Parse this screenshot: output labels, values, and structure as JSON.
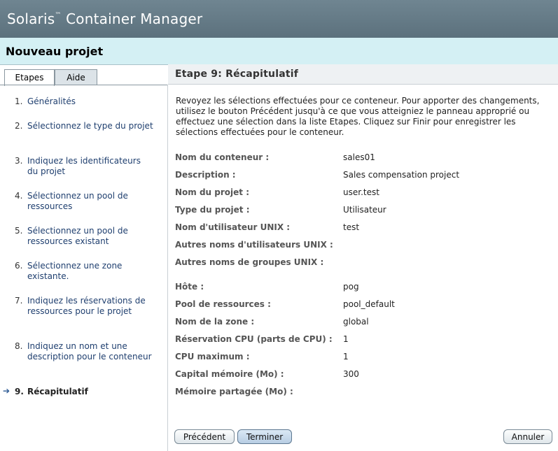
{
  "app": {
    "title": "Solaris",
    "trademark": "™",
    "title_rest": " Container Manager"
  },
  "page_title": "Nouveau projet",
  "tabs": [
    {
      "label": "Etapes",
      "active": true
    },
    {
      "label": "Aide",
      "active": false
    }
  ],
  "steps": [
    {
      "num": "1.",
      "label": "Généralités"
    },
    {
      "num": "2.",
      "label": "Sélectionnez le type du projet"
    },
    {
      "num": "3.",
      "label": "Indiquez les identificateurs du projet"
    },
    {
      "num": "4.",
      "label": "Sélectionnez un pool de ressources"
    },
    {
      "num": "5.",
      "label": "Sélectionnez un pool de ressources existant"
    },
    {
      "num": "6.",
      "label": "Sélectionnez une zone existante."
    },
    {
      "num": "7.",
      "label": "Indiquez les réservations de ressources pour le projet"
    },
    {
      "num": "8.",
      "label": "Indiquez un nom et une description pour le conteneur"
    },
    {
      "num": "9.",
      "label": "Récapitulatif",
      "current": true
    }
  ],
  "step_header": "Etape 9:  Récapitulatif",
  "intro": "Revoyez les sélections effectuées pour ce conteneur. Pour apporter des changements, utilisez le bouton Précédent jusqu'à ce que vous atteigniez le panneau approprié ou effectuez une sélection dans la liste Etapes. Cliquez sur Finir pour enregistrer les sélections effectuées pour le conteneur.",
  "summary": [
    {
      "label": "Nom du conteneur :",
      "value": "sales01"
    },
    {
      "label": "Description :",
      "value": "Sales compensation project"
    },
    {
      "label": "Nom du projet :",
      "value": "user.test"
    },
    {
      "label": "Type du projet :",
      "value": "Utilisateur"
    },
    {
      "label": "Nom d'utilisateur UNIX :",
      "value": "test"
    },
    {
      "label": "Autres noms d'utilisateurs UNIX :",
      "value": ""
    },
    {
      "label": "Autres noms de groupes UNIX :",
      "value": ""
    },
    {
      "label": "Hôte :",
      "value": "pog"
    },
    {
      "label": "Pool de ressources :",
      "value": "pool_default"
    },
    {
      "label": "Nom de la zone :",
      "value": "global"
    },
    {
      "label": "Réservation CPU (parts de CPU) :",
      "value": "1"
    },
    {
      "label": "CPU maximum :",
      "value": "1"
    },
    {
      "label": "Capital mémoire (Mo) :",
      "value": "300"
    },
    {
      "label": "Mémoire partagée (Mo) :",
      "value": ""
    }
  ],
  "buttons": {
    "previous": "Précédent",
    "finish": "Terminer",
    "cancel": "Annuler"
  },
  "icons": {
    "current_step": "arrow-right-icon"
  }
}
